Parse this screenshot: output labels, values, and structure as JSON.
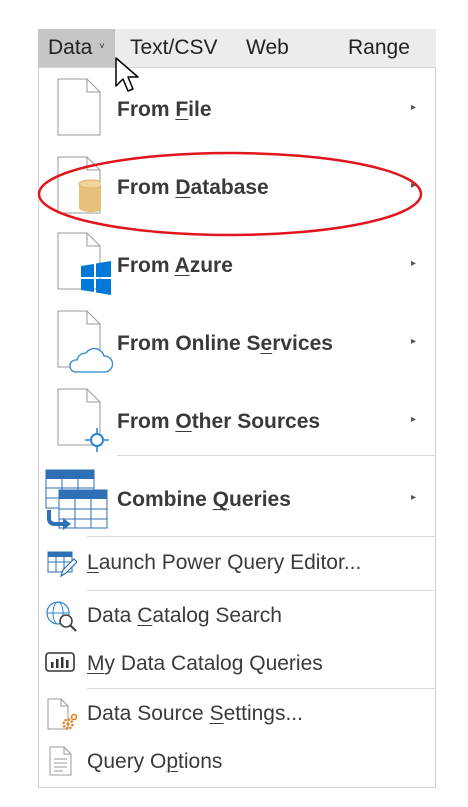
{
  "ribbon": {
    "tabs": [
      {
        "label": "Data",
        "active": true
      },
      {
        "label": "Text/CSV"
      },
      {
        "label": "Web"
      },
      {
        "label": "Range"
      }
    ],
    "caret": "˅"
  },
  "menu": {
    "big_items": [
      {
        "pre": "From ",
        "u": "F",
        "post": "ile",
        "icon": "file-icon"
      },
      {
        "pre": "From ",
        "u": "D",
        "post": "atabase",
        "icon": "database-icon",
        "highlighted": true
      },
      {
        "pre": "From ",
        "u": "A",
        "post": "zure",
        "icon": "azure-icon"
      },
      {
        "pre": "From Online S",
        "u": "e",
        "post": "rvices",
        "icon": "cloud-icon"
      },
      {
        "pre": "From ",
        "u": "O",
        "post": "ther Sources",
        "icon": "other-sources-icon"
      },
      {
        "pre": "Combine ",
        "u": "Q",
        "post": "ueries",
        "icon": "combine-queries-icon"
      }
    ],
    "small_items": [
      {
        "pre": "",
        "u": "L",
        "post": "aunch Power Query Editor...",
        "icon": "power-query-editor-icon"
      },
      {
        "pre": "Data ",
        "u": "C",
        "post": "atalog Search",
        "icon": "catalog-search-icon"
      },
      {
        "pre": "",
        "u": "M",
        "post": "y Data Catalog Queries",
        "icon": "catalog-queries-icon"
      },
      {
        "pre": "Data Source ",
        "u": "S",
        "post": "ettings...",
        "icon": "data-source-settings-icon"
      },
      {
        "pre": "Query O",
        "u": "p",
        "post": "tions",
        "icon": "query-options-icon"
      }
    ],
    "submenu_arrow": "▸"
  },
  "colors": {
    "highlight_ellipse": "#e0161c",
    "azure": "#0078d7",
    "database": "#e6c07b"
  }
}
